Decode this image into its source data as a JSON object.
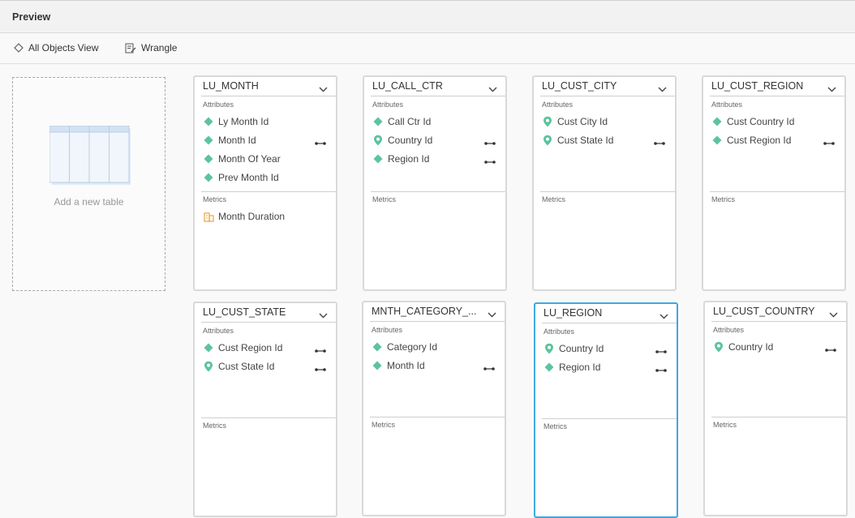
{
  "header": {
    "title": "Preview"
  },
  "toolbar": {
    "all_objects": "All Objects View",
    "wrangle": "Wrangle"
  },
  "add_table": {
    "label": "Add a new table"
  },
  "labels": {
    "attributes": "Attributes",
    "metrics": "Metrics"
  },
  "colors": {
    "attribute": "#5cc49c",
    "metric": "#e8a33c",
    "selected": "#3fa8dd"
  },
  "tables": [
    {
      "name": "LU_MONTH",
      "attributes": [
        {
          "label": "Ly Month Id",
          "icon": "diamond-icon",
          "linked": false
        },
        {
          "label": "Month Id",
          "icon": "diamond-icon",
          "linked": true
        },
        {
          "label": "Month Of Year",
          "icon": "diamond-icon",
          "linked": false
        },
        {
          "label": "Prev Month Id",
          "icon": "diamond-icon",
          "linked": false
        }
      ],
      "metrics": [
        {
          "label": "Month Duration",
          "icon": "metric-icon"
        }
      ]
    },
    {
      "name": "LU_CALL_CTR",
      "attributes": [
        {
          "label": "Call Ctr Id",
          "icon": "diamond-icon",
          "linked": false
        },
        {
          "label": "Country Id",
          "icon": "location-pin-icon",
          "linked": true
        },
        {
          "label": "Region Id",
          "icon": "diamond-icon",
          "linked": true
        }
      ],
      "metrics": []
    },
    {
      "name": "LU_CUST_CITY",
      "attributes": [
        {
          "label": "Cust City Id",
          "icon": "location-pin-icon",
          "linked": false
        },
        {
          "label": "Cust State Id",
          "icon": "location-pin-icon",
          "linked": true
        }
      ],
      "metrics": []
    },
    {
      "name": "LU_CUST_REGION",
      "attributes": [
        {
          "label": "Cust Country Id",
          "icon": "diamond-icon",
          "linked": false
        },
        {
          "label": "Cust Region Id",
          "icon": "diamond-icon",
          "linked": true
        }
      ],
      "metrics": []
    },
    {
      "name": "LU_CUST_STATE",
      "attributes": [
        {
          "label": "Cust Region Id",
          "icon": "diamond-icon",
          "linked": true
        },
        {
          "label": "Cust State Id",
          "icon": "location-pin-icon",
          "linked": true
        }
      ],
      "metrics": []
    },
    {
      "name": "MNTH_CATEGORY_...",
      "attributes": [
        {
          "label": "Category Id",
          "icon": "diamond-icon",
          "linked": false
        },
        {
          "label": "Month Id",
          "icon": "diamond-icon",
          "linked": true
        }
      ],
      "metrics": []
    },
    {
      "name": "LU_REGION",
      "selected": true,
      "attributes": [
        {
          "label": "Country Id",
          "icon": "location-pin-icon",
          "linked": true
        },
        {
          "label": "Region Id",
          "icon": "diamond-icon",
          "linked": true
        }
      ],
      "metrics": []
    },
    {
      "name": "LU_CUST_COUNTRY",
      "attributes": [
        {
          "label": "Country Id",
          "icon": "location-pin-icon",
          "linked": true
        }
      ],
      "metrics": []
    }
  ]
}
